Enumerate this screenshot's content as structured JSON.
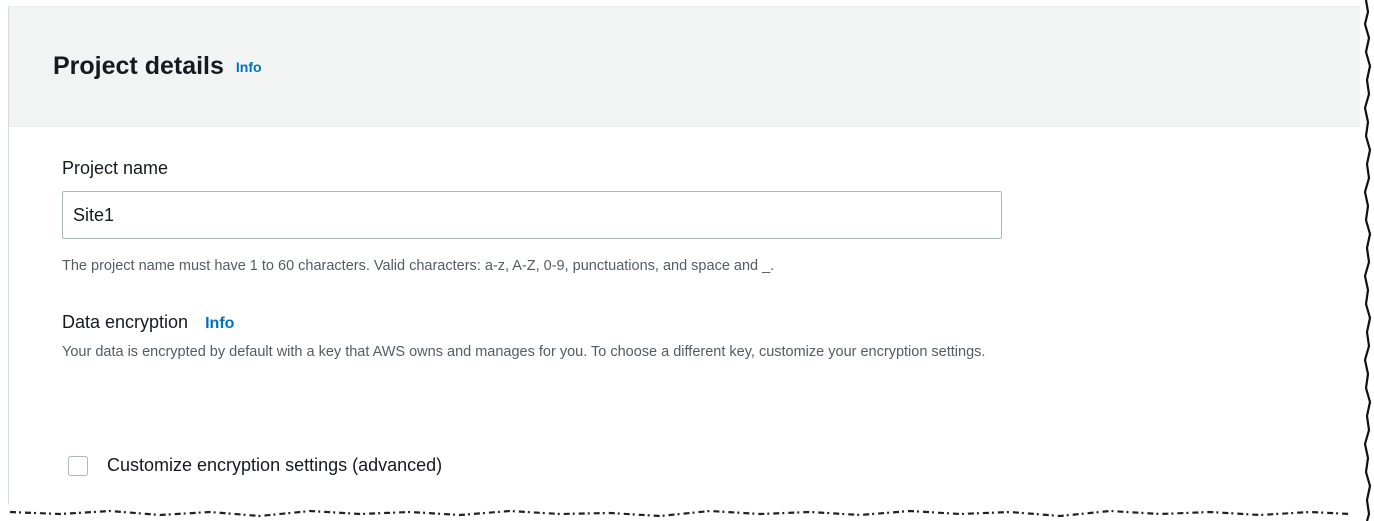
{
  "panel": {
    "title": "Project details",
    "info_label": "Info"
  },
  "project_name": {
    "label": "Project name",
    "value": "Site1",
    "hint": "The project name must have 1 to 60 characters. Valid characters: a-z, A-Z, 0-9, punctuations, and space and _."
  },
  "data_encryption": {
    "label": "Data encryption",
    "info_label": "Info",
    "description": "Your data is encrypted by default with a key that AWS owns and manages for you. To choose a different key, customize your encryption settings."
  },
  "customize_encryption": {
    "label": "Customize encryption settings (advanced)",
    "checked": false
  }
}
